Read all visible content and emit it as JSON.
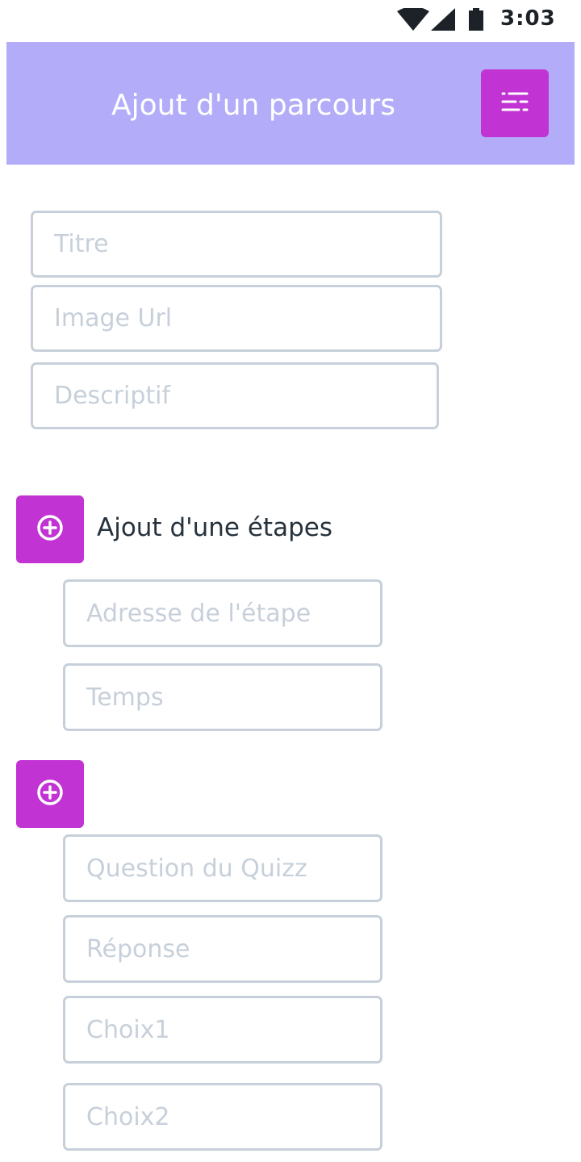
{
  "status_bar": {
    "time": "3:03",
    "icons": [
      "wifi-icon",
      "signal-icon",
      "battery-icon"
    ]
  },
  "header": {
    "title": "Ajout d'un parcours",
    "menu_icon": "sliders-icon",
    "background_color": "#b2acf9"
  },
  "form": {
    "title_placeholder": "Titre",
    "image_url_placeholder": "Image Url",
    "description_placeholder": "Descriptif"
  },
  "step": {
    "add_label": "Ajout d'une étapes",
    "add_icon": "plus-circle-icon",
    "address_placeholder": "Adresse de l'étape",
    "time_placeholder": "Temps"
  },
  "quiz": {
    "add_icon": "plus-circle-icon",
    "question_placeholder": "Question du Quizz",
    "answer_placeholder": "Réponse",
    "choice1_placeholder": "Choix1",
    "choice2_placeholder": "Choix2"
  },
  "colors": {
    "accent": "#c133d2",
    "input_border": "#c7d0da",
    "placeholder": "#c7d0da",
    "text_dark": "#26323c"
  }
}
